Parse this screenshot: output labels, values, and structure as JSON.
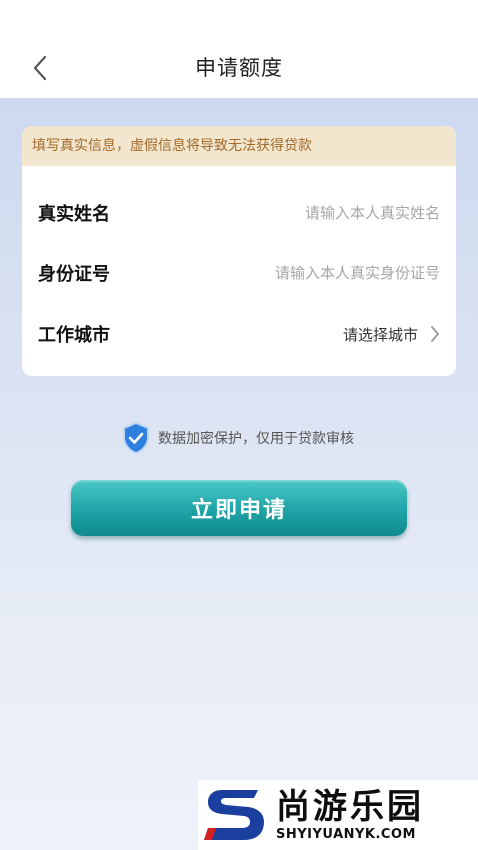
{
  "header": {
    "title": "申请额度"
  },
  "form": {
    "warning": "填写真实信息，虚假信息将导致无法获得贷款",
    "name_label": "真实姓名",
    "name_placeholder": "请输入本人真实姓名",
    "id_label": "身份证号",
    "id_placeholder": "请输入本人真实身份证号",
    "city_label": "工作城市",
    "city_value": "请选择城市"
  },
  "security": {
    "text": "数据加密保护，仅用于贷款审核"
  },
  "actions": {
    "apply_label": "立即申请"
  },
  "watermark": {
    "brand": "尚游乐园",
    "domain": "SHYIYUANYK.COM"
  },
  "colors": {
    "accent": "#1ea3a6",
    "warning_bg": "#f2e6cf",
    "warning_text": "#a36a2a",
    "page_bg": "#cdd9f0"
  },
  "icons": [
    "chevron-left-icon",
    "chevron-right-icon",
    "shield-check-icon"
  ]
}
